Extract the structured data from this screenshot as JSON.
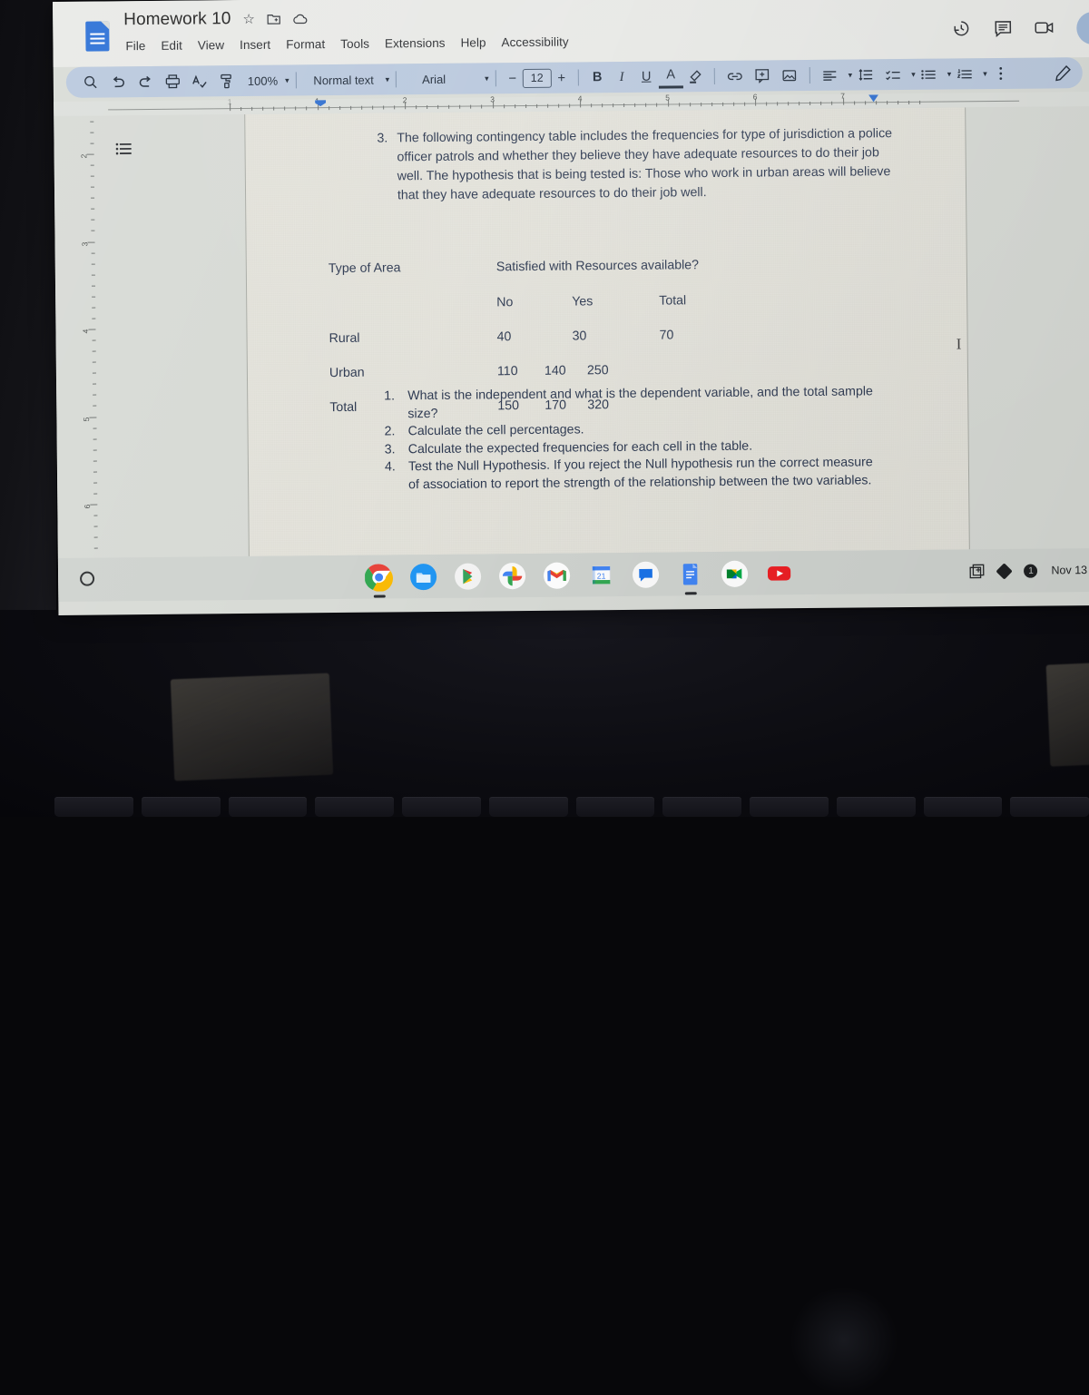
{
  "app": {
    "name": "Google Docs",
    "doc_title": "Homework 10",
    "title_icons": [
      "star-icon",
      "move-to-folder-icon",
      "cloud-saved-icon"
    ],
    "menus": [
      "File",
      "Edit",
      "View",
      "Insert",
      "Format",
      "Tools",
      "Extensions",
      "Help",
      "Accessibility"
    ],
    "header_right_icons": [
      "version-history-icon",
      "comments-icon",
      "meet-camera-icon"
    ],
    "header_right_caret": "▾"
  },
  "toolbar": {
    "search_icon": "search-icon",
    "undo_icon": "undo-icon",
    "redo_icon": "redo-icon",
    "print_icon": "print-icon",
    "spellcheck_icon": "spellcheck-icon",
    "paint_format_icon": "paint-format-icon",
    "zoom_value": "100%",
    "style_value": "Normal text",
    "font_value": "Arial",
    "font_size_value": "12",
    "font_size_minus": "−",
    "font_size_plus": "+",
    "bold_label": "B",
    "italic_label": "I",
    "underline_label": "U",
    "text_color_label": "A",
    "highlight_icon": "highlight-pen-icon",
    "link_icon": "insert-link-icon",
    "comment_icon": "add-comment-icon",
    "image_icon": "insert-image-icon",
    "align_icon": "align-left-icon",
    "line_spacing_icon": "line-spacing-icon",
    "checklist_icon": "checklist-icon",
    "bulleted_list_icon": "bulleted-list-icon",
    "numbered_list_icon": "numbered-list-icon",
    "more_icon": "more-options-icon",
    "editing_mode_icon": "editing-mode-pencil-icon",
    "caret": "▾"
  },
  "ruler": {
    "horizontal_numbers": [
      "1",
      "1",
      "2",
      "3",
      "4",
      "5",
      "6",
      "7"
    ],
    "vertical_numbers": [
      "2",
      "3",
      "4",
      "5",
      "6"
    ],
    "indent_marker": "first-line-indent-marker",
    "right_indent_marker": "right-indent-marker"
  },
  "outline_button_icon": "document-outline-icon",
  "document": {
    "question": {
      "number": "3.",
      "text": "The following contingency table includes the frequencies for type of jurisdiction a police officer patrols and whether they believe they have adequate resources to do their job well. The hypothesis that is being tested is: Those who work in urban areas will believe that they have adequate resources to do their job well."
    },
    "table": {
      "row_header": "Type of Area",
      "col_header": "Satisfied with Resources available?",
      "columns": [
        "No",
        "Yes",
        "Total"
      ],
      "rows": [
        {
          "label": "Rural",
          "values": [
            "40",
            "30",
            "70"
          ]
        },
        {
          "label": "Urban",
          "values": [
            "110",
            "140",
            "250"
          ]
        },
        {
          "label": "Total",
          "values": [
            "150",
            "170",
            "320"
          ]
        }
      ]
    },
    "steps": [
      {
        "num": "1.",
        "text": "What is the independent and what is the dependent variable, and the total sample size?"
      },
      {
        "num": "2.",
        "text": "Calculate the cell percentages."
      },
      {
        "num": "3.",
        "text": "Calculate the expected frequencies for each cell in the table."
      },
      {
        "num": "4.",
        "text": "Test the Null Hypothesis. If you reject the Null hypothesis run the correct measure of association to report the strength of the relationship between the two variables."
      }
    ],
    "text_cursor": "I"
  },
  "shelf": {
    "launcher_icon": "launcher-circle-icon",
    "apps": [
      {
        "name": "chrome-icon",
        "running": true
      },
      {
        "name": "files-icon",
        "running": false
      },
      {
        "name": "play-store-icon",
        "running": false
      },
      {
        "name": "google-photos-icon",
        "running": false
      },
      {
        "name": "gmail-icon",
        "running": false
      },
      {
        "name": "google-calendar-icon",
        "running": false
      },
      {
        "name": "google-chat-icon",
        "running": false
      },
      {
        "name": "google-docs-icon",
        "running": true
      },
      {
        "name": "google-meet-icon",
        "running": false
      },
      {
        "name": "youtube-icon",
        "running": false
      }
    ],
    "tray": {
      "screenshot_icon": "capture-mode-icon",
      "status_icon": "status-icon",
      "notification_count": "1",
      "date": "Nov 13"
    }
  },
  "colors": {
    "docs_blue": "#2a6fd6",
    "toolbar_bg": "#b9c8dd",
    "page_bg": "#e3e2da",
    "text_ink": "#2c3850",
    "indent_marker": "#2f6fd0"
  }
}
